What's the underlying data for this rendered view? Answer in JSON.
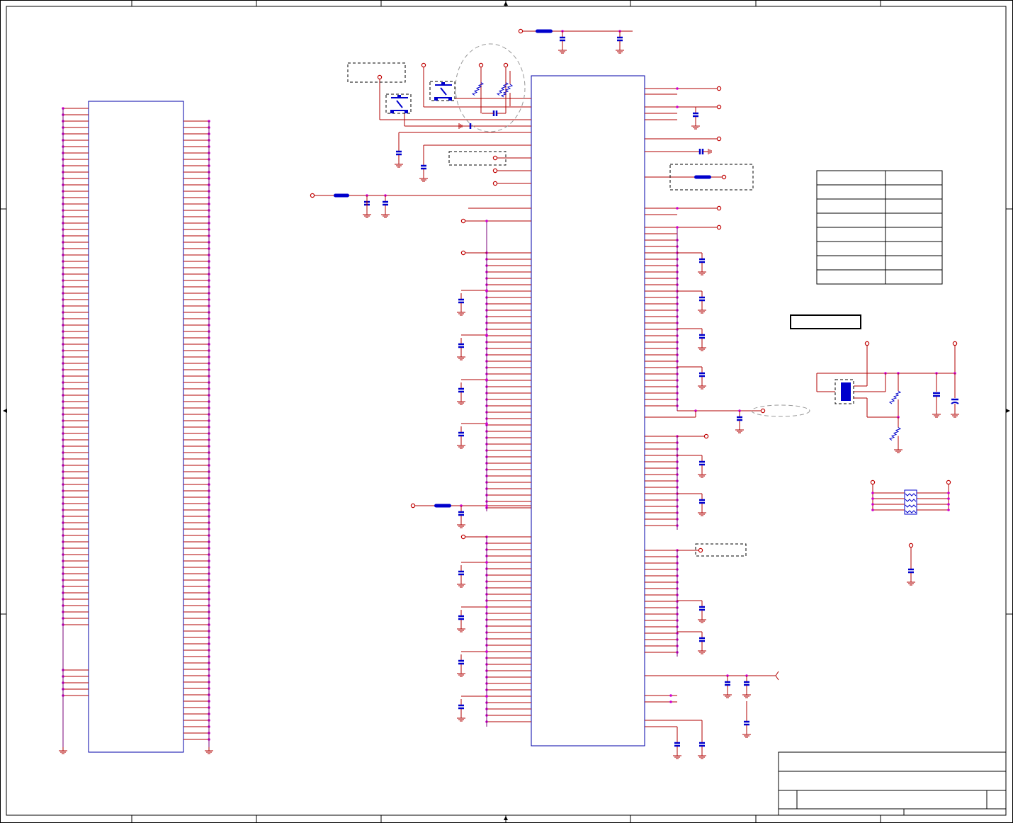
{
  "diagram": {
    "type": "electrical-schematic",
    "colors": {
      "wire": "#b00000",
      "net": "#7a007a",
      "component_outline": "#0000aa",
      "junction": "#d000d0",
      "capacitor": "#0000cc"
    },
    "components": [
      {
        "name": "connector-block",
        "kind": "connector"
      },
      {
        "name": "main-ic",
        "kind": "integrated-circuit"
      },
      {
        "name": "transistor-q1",
        "kind": "transistor"
      },
      {
        "name": "transistor-q2",
        "kind": "transistor"
      },
      {
        "name": "voltage-regulator",
        "kind": "regulator"
      },
      {
        "name": "resistor-array",
        "kind": "resistor-network"
      }
    ],
    "info_table": {
      "rows": 8,
      "cols": 2
    },
    "title_block": {}
  }
}
